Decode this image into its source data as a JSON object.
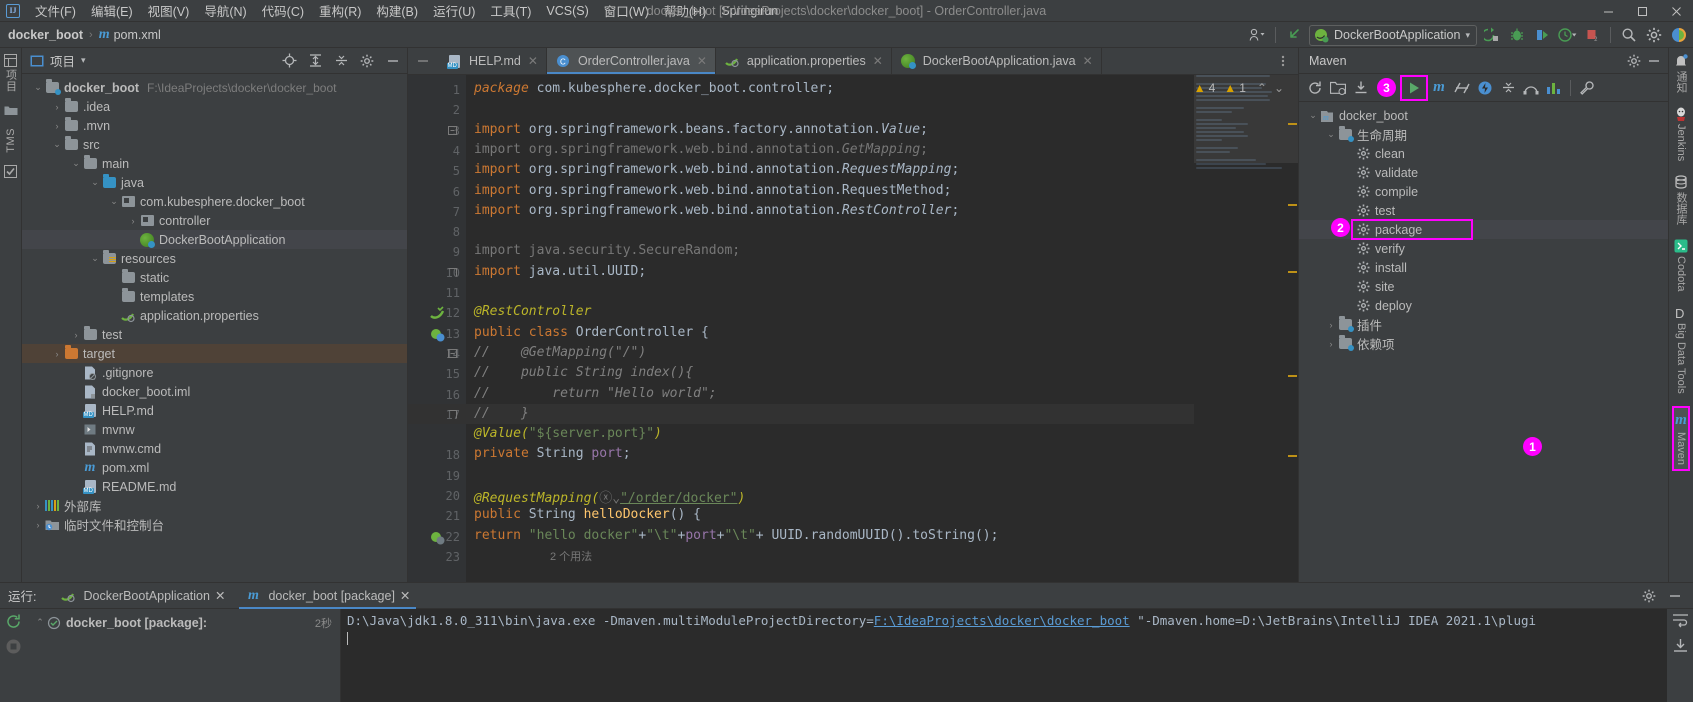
{
  "window": {
    "title": "docker_boot [F:\\IdeaProjects\\docker\\docker_boot] - OrderController.java",
    "minimize": "—",
    "maximize": "☐",
    "close": "✕"
  },
  "menu": {
    "items": [
      {
        "label": "文件(F)",
        "name": "menu-file"
      },
      {
        "label": "编辑(E)",
        "name": "menu-edit"
      },
      {
        "label": "视图(V)",
        "name": "menu-view"
      },
      {
        "label": "导航(N)",
        "name": "menu-navigate"
      },
      {
        "label": "代码(C)",
        "name": "menu-code"
      },
      {
        "label": "重构(R)",
        "name": "menu-refactor"
      },
      {
        "label": "构建(B)",
        "name": "menu-build"
      },
      {
        "label": "运行(U)",
        "name": "menu-run"
      },
      {
        "label": "工具(T)",
        "name": "menu-tools"
      },
      {
        "label": "VCS(S)",
        "name": "menu-vcs"
      },
      {
        "label": "窗口(W)",
        "name": "menu-window"
      },
      {
        "label": "帮助(H)",
        "name": "menu-help"
      },
      {
        "label": "Springirun",
        "name": "menu-springirun"
      }
    ]
  },
  "navbar": {
    "crumb_project": "docker_boot",
    "crumb_sep": "›",
    "crumb_file": "pom.xml",
    "run_config": "DockerBootApplication",
    "chevron": "▾"
  },
  "left_strip": {
    "project_label": "项目",
    "tms_label": "TMS"
  },
  "project_panel": {
    "title": "项目",
    "chevron": "▾",
    "tree": [
      {
        "label": "docker_boot",
        "sub": "F:\\IdeaProjects\\docker\\docker_boot",
        "depth": 0,
        "arrow": "⌄",
        "icon": "module-icon",
        "bold": true,
        "state": ""
      },
      {
        "label": ".idea",
        "sub": "",
        "depth": 1,
        "arrow": "›",
        "icon": "folder-icon",
        "bold": false,
        "state": ""
      },
      {
        "label": ".mvn",
        "sub": "",
        "depth": 1,
        "arrow": "›",
        "icon": "folder-icon",
        "bold": false,
        "state": ""
      },
      {
        "label": "src",
        "sub": "",
        "depth": 1,
        "arrow": "⌄",
        "icon": "folder-icon",
        "bold": false,
        "state": ""
      },
      {
        "label": "main",
        "sub": "",
        "depth": 2,
        "arrow": "⌄",
        "icon": "folder-icon",
        "bold": false,
        "state": ""
      },
      {
        "label": "java",
        "sub": "",
        "depth": 3,
        "arrow": "⌄",
        "icon": "source-folder-icon",
        "bold": false,
        "state": ""
      },
      {
        "label": "com.kubesphere.docker_boot",
        "sub": "",
        "depth": 4,
        "arrow": "⌄",
        "icon": "package-icon",
        "bold": false,
        "state": ""
      },
      {
        "label": "controller",
        "sub": "",
        "depth": 5,
        "arrow": "›",
        "icon": "package-icon",
        "bold": false,
        "state": ""
      },
      {
        "label": "DockerBootApplication",
        "sub": "",
        "depth": 5,
        "arrow": "",
        "icon": "spring-class-icon",
        "bold": false,
        "state": "sel2"
      },
      {
        "label": "resources",
        "sub": "",
        "depth": 3,
        "arrow": "⌄",
        "icon": "resources-folder-icon",
        "bold": false,
        "state": ""
      },
      {
        "label": "static",
        "sub": "",
        "depth": 4,
        "arrow": "",
        "icon": "folder-icon",
        "bold": false,
        "state": ""
      },
      {
        "label": "templates",
        "sub": "",
        "depth": 4,
        "arrow": "",
        "icon": "folder-icon",
        "bold": false,
        "state": ""
      },
      {
        "label": "application.properties",
        "sub": "",
        "depth": 4,
        "arrow": "",
        "icon": "spring-properties-icon",
        "bold": false,
        "state": ""
      },
      {
        "label": "test",
        "sub": "",
        "depth": 2,
        "arrow": "›",
        "icon": "folder-icon",
        "bold": false,
        "state": ""
      },
      {
        "label": "target",
        "sub": "",
        "depth": 1,
        "arrow": "›",
        "icon": "excluded-folder-icon",
        "bold": false,
        "state": "sel"
      },
      {
        "label": ".gitignore",
        "sub": "",
        "depth": 2,
        "arrow": "",
        "icon": "gitignore-file-icon",
        "bold": false,
        "state": ""
      },
      {
        "label": "docker_boot.iml",
        "sub": "",
        "depth": 2,
        "arrow": "",
        "icon": "iml-file-icon",
        "bold": false,
        "state": ""
      },
      {
        "label": "HELP.md",
        "sub": "",
        "depth": 2,
        "arrow": "",
        "icon": "markdown-file-icon",
        "bold": false,
        "state": ""
      },
      {
        "label": "mvnw",
        "sub": "",
        "depth": 2,
        "arrow": "",
        "icon": "script-file-icon",
        "bold": false,
        "state": ""
      },
      {
        "label": "mvnw.cmd",
        "sub": "",
        "depth": 2,
        "arrow": "",
        "icon": "cmd-file-icon",
        "bold": false,
        "state": ""
      },
      {
        "label": "pom.xml",
        "sub": "",
        "depth": 2,
        "arrow": "",
        "icon": "maven-file-icon",
        "bold": false,
        "state": ""
      },
      {
        "label": "README.md",
        "sub": "",
        "depth": 2,
        "arrow": "",
        "icon": "markdown-file-icon",
        "bold": false,
        "state": ""
      },
      {
        "label": "外部库",
        "sub": "",
        "depth": 0,
        "arrow": "›",
        "icon": "library-icon",
        "bold": false,
        "state": ""
      },
      {
        "label": "临时文件和控制台",
        "sub": "",
        "depth": 0,
        "arrow": "›",
        "icon": "scratches-icon",
        "bold": false,
        "state": ""
      }
    ]
  },
  "editor": {
    "tabs": [
      {
        "label": "HELP.md",
        "icon": "markdown-file-icon",
        "active": false
      },
      {
        "label": "OrderController.java",
        "icon": "java-class-icon",
        "active": true
      },
      {
        "label": "application.properties",
        "icon": "spring-properties-icon",
        "active": false
      },
      {
        "label": "DockerBootApplication.java",
        "icon": "spring-class-icon",
        "active": false
      }
    ],
    "close_glyph": "✕",
    "inspections": {
      "warning_count": "4",
      "error_count": "1",
      "up": "⌃",
      "down": "⌄"
    },
    "usages_hint": "2 个用法",
    "lines": [
      {
        "n": "1",
        "segs": [
          {
            "t": "package ",
            "c": "pkw-i"
          },
          {
            "t": "com.kubesphere.docker_boot.controller;",
            "c": "id"
          }
        ]
      },
      {
        "n": "2",
        "segs": []
      },
      {
        "n": "3",
        "segs": [
          {
            "t": "import ",
            "c": "pkw"
          },
          {
            "t": "org.springframework.beans.factory.annotation.",
            "c": "id"
          },
          {
            "t": "Value",
            "c": "id-i"
          },
          {
            "t": ";",
            "c": "id"
          }
        ]
      },
      {
        "n": "4",
        "segs": [
          {
            "t": "import ",
            "c": "dim"
          },
          {
            "t": "org.springframework.web.bind.annotation.",
            "c": "dim"
          },
          {
            "t": "GetMapping",
            "c": "dim-i"
          },
          {
            "t": ";",
            "c": "dim"
          }
        ]
      },
      {
        "n": "5",
        "segs": [
          {
            "t": "import ",
            "c": "pkw"
          },
          {
            "t": "org.springframework.web.bind.annotation.",
            "c": "id"
          },
          {
            "t": "RequestMapping",
            "c": "id-i"
          },
          {
            "t": ";",
            "c": "id"
          }
        ]
      },
      {
        "n": "6",
        "segs": [
          {
            "t": "import ",
            "c": "pkw"
          },
          {
            "t": "org.springframework.web.bind.annotation.RequestMethod;",
            "c": "id"
          }
        ]
      },
      {
        "n": "7",
        "segs": [
          {
            "t": "import ",
            "c": "pkw"
          },
          {
            "t": "org.springframework.web.bind.annotation.",
            "c": "id"
          },
          {
            "t": "RestController",
            "c": "id-i"
          },
          {
            "t": ";",
            "c": "id"
          }
        ]
      },
      {
        "n": "8",
        "segs": []
      },
      {
        "n": "9",
        "segs": [
          {
            "t": "import java.security.SecureRandom;",
            "c": "dim"
          }
        ]
      },
      {
        "n": "10",
        "segs": [
          {
            "t": "import ",
            "c": "pkw"
          },
          {
            "t": "java.util.UUID;",
            "c": "id"
          }
        ]
      },
      {
        "n": "11",
        "segs": []
      },
      {
        "n": "12",
        "segs": [
          {
            "t": "@RestController",
            "c": "ann-i"
          }
        ]
      },
      {
        "n": "13",
        "segs": [
          {
            "t": "public ",
            "c": "pkw"
          },
          {
            "t": "class ",
            "c": "pkw"
          },
          {
            "t": "OrderController ",
            "c": "id"
          },
          {
            "t": "{",
            "c": "id"
          }
        ]
      },
      {
        "n": "14",
        "segs": [
          {
            "t": "//    @GetMapping(\"/\")",
            "c": "cmt"
          }
        ]
      },
      {
        "n": "15",
        "segs": [
          {
            "t": "//    public String index(){",
            "c": "cmt"
          }
        ]
      },
      {
        "n": "16",
        "segs": [
          {
            "t": "//        return \"Hello world\";",
            "c": "cmt"
          }
        ]
      },
      {
        "n": "17",
        "segs": [
          {
            "t": "//    }",
            "c": "cmt"
          }
        ]
      },
      {
        "n": "18",
        "segs": [
          {
            "t": "@Value(",
            "c": "ann-i"
          },
          {
            "t": "\"${server.port}\"",
            "c": "str"
          },
          {
            "t": ")",
            "c": "ann-i"
          }
        ]
      },
      {
        "n": "19",
        "segs": [
          {
            "t": "private ",
            "c": "pkw"
          },
          {
            "t": "String ",
            "c": "id"
          },
          {
            "t": "port",
            "c": "fld"
          },
          {
            "t": ";",
            "c": "id"
          }
        ]
      },
      {
        "n": "20",
        "segs": []
      },
      {
        "n": "21",
        "segs": [
          {
            "t": "@RequestMapping(",
            "c": "ann-i"
          },
          {
            "t": "ⓧ⌄",
            "c": "dim"
          },
          {
            "t": "\"/order/docker\"",
            "c": "str-u"
          },
          {
            "t": ")",
            "c": "ann-i"
          }
        ]
      },
      {
        "n": "22",
        "segs": [
          {
            "t": "public ",
            "c": "pkw"
          },
          {
            "t": "String ",
            "c": "id"
          },
          {
            "t": "helloDocker",
            "c": "meth"
          },
          {
            "t": "() {",
            "c": "id"
          }
        ]
      },
      {
        "n": "23",
        "segs": [
          {
            "t": "return ",
            "c": "pkw"
          },
          {
            "t": "\"hello docker\"",
            "c": "str"
          },
          {
            "t": "+",
            "c": "id"
          },
          {
            "t": "\"\\t\"",
            "c": "str"
          },
          {
            "t": "+",
            "c": "id"
          },
          {
            "t": "port",
            "c": "fld"
          },
          {
            "t": "+",
            "c": "id"
          },
          {
            "t": "\"\\t\"",
            "c": "str"
          },
          {
            "t": "+ ",
            "c": "id"
          },
          {
            "t": "UUID",
            "c": "id"
          },
          {
            "t": ".randomUUID().",
            "c": "id"
          },
          {
            "t": "toString",
            "c": "id"
          },
          {
            "t": "();",
            "c": "id"
          }
        ]
      }
    ]
  },
  "maven_panel": {
    "title": "Maven",
    "settings_glyph": "⚙",
    "minimize_glyph": "—",
    "toolbar_badge": "3",
    "tree": [
      {
        "label": "docker_boot",
        "depth": 0,
        "arrow": "⌄",
        "icon": "maven-project-icon",
        "state": ""
      },
      {
        "label": "生命周期",
        "depth": 1,
        "arrow": "⌄",
        "icon": "lifecycle-folder-icon",
        "state": ""
      },
      {
        "label": "clean",
        "depth": 2,
        "arrow": "",
        "icon": "goal-icon",
        "state": ""
      },
      {
        "label": "validate",
        "depth": 2,
        "arrow": "",
        "icon": "goal-icon",
        "state": ""
      },
      {
        "label": "compile",
        "depth": 2,
        "arrow": "",
        "icon": "goal-icon",
        "state": ""
      },
      {
        "label": "test",
        "depth": 2,
        "arrow": "",
        "icon": "goal-icon",
        "state": ""
      },
      {
        "label": "package",
        "depth": 2,
        "arrow": "",
        "icon": "goal-icon",
        "state": "highlight"
      },
      {
        "label": "verify",
        "depth": 2,
        "arrow": "",
        "icon": "goal-icon",
        "state": ""
      },
      {
        "label": "install",
        "depth": 2,
        "arrow": "",
        "icon": "goal-icon",
        "state": ""
      },
      {
        "label": "site",
        "depth": 2,
        "arrow": "",
        "icon": "goal-icon",
        "state": ""
      },
      {
        "label": "deploy",
        "depth": 2,
        "arrow": "",
        "icon": "goal-icon",
        "state": ""
      },
      {
        "label": "插件",
        "depth": 1,
        "arrow": "›",
        "icon": "plugins-folder-icon",
        "state": ""
      },
      {
        "label": "依赖项",
        "depth": 1,
        "arrow": "›",
        "icon": "dependencies-folder-icon",
        "state": ""
      }
    ],
    "package_badge": "2"
  },
  "right_strip": {
    "items": [
      {
        "label": "通知",
        "icon": "notifications-icon",
        "highlight": false
      },
      {
        "label": "Jenkins",
        "icon": "jenkins-icon",
        "highlight": false
      },
      {
        "label": "数据库",
        "icon": "database-icon",
        "highlight": false
      },
      {
        "label": "Codota",
        "icon": "codota-icon",
        "highlight": false
      },
      {
        "label": "Big Data Tools",
        "icon": "bigdatatools-icon",
        "highlight": false
      },
      {
        "label": "Maven",
        "icon": "maven-icon",
        "highlight": true
      }
    ],
    "maven_badge": "1"
  },
  "run_panel": {
    "label": "运行:",
    "tabs": [
      {
        "label": "DockerBootApplication",
        "icon": "spring-run-icon",
        "active": false
      },
      {
        "label": "docker_boot [package]",
        "icon": "maven-run-icon",
        "active": true
      }
    ],
    "close_glyph": "✕",
    "settings_glyph": "⚙",
    "minimize_glyph": "—",
    "tree_root": "docker_boot [package]:",
    "tree_count": "2秒",
    "console_prefix": "D:\\Java\\jdk1.8.0_311\\bin\\java.exe -Dmaven.multiModuleProjectDirectory=",
    "console_link": "F:\\IdeaProjects\\docker\\docker_boot",
    "console_suffix": " \"-Dmaven.home=D:\\JetBrains\\IntelliJ IDEA 2021.1\\plugi"
  },
  "colors": {
    "accent": "#4a88c7",
    "highlight_magenta": "#ff00ff",
    "selection_orange": "#4f4237",
    "bg_panel": "#3c3f41",
    "bg_editor": "#2b2b2b"
  }
}
